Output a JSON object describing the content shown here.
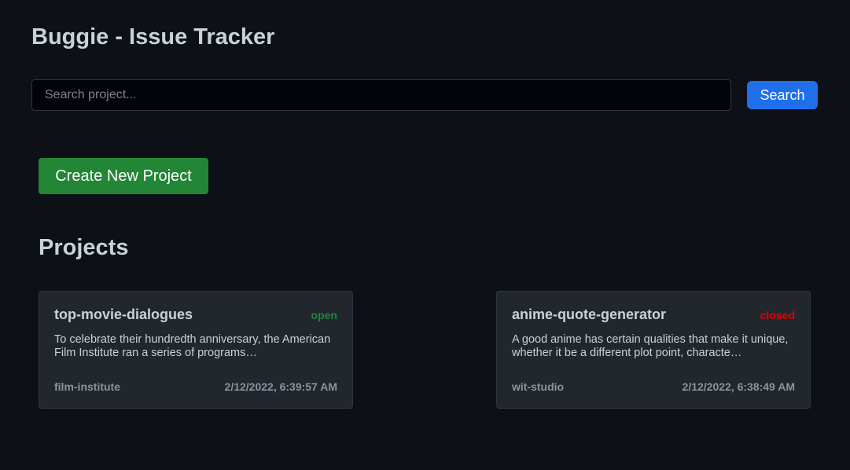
{
  "app": {
    "title": "Buggie - Issue Tracker"
  },
  "search": {
    "placeholder": "Search project...",
    "value": "",
    "button_label": "Search"
  },
  "actions": {
    "create_label": "Create New Project"
  },
  "projects_heading": "Projects",
  "projects": [
    {
      "name": "top-movie-dialogues",
      "status": "open",
      "description": "To celebrate their hundredth anniversary, the American Film Institute ran a series of programs…",
      "owner": "film-institute",
      "timestamp": "2/12/2022, 6:39:57 AM"
    },
    {
      "name": "anime-quote-generator",
      "status": "closed",
      "description": "A good anime has certain qualities that make it unique, whether it be a different plot point, characte…",
      "owner": "wit-studio",
      "timestamp": "2/12/2022, 6:38:49 AM"
    }
  ],
  "colors": {
    "background": "#0d1117",
    "card_background": "#22272e",
    "primary_button": "#1f6feb",
    "success_button": "#238636",
    "status_open": "#238636",
    "status_closed": "#e00000"
  }
}
